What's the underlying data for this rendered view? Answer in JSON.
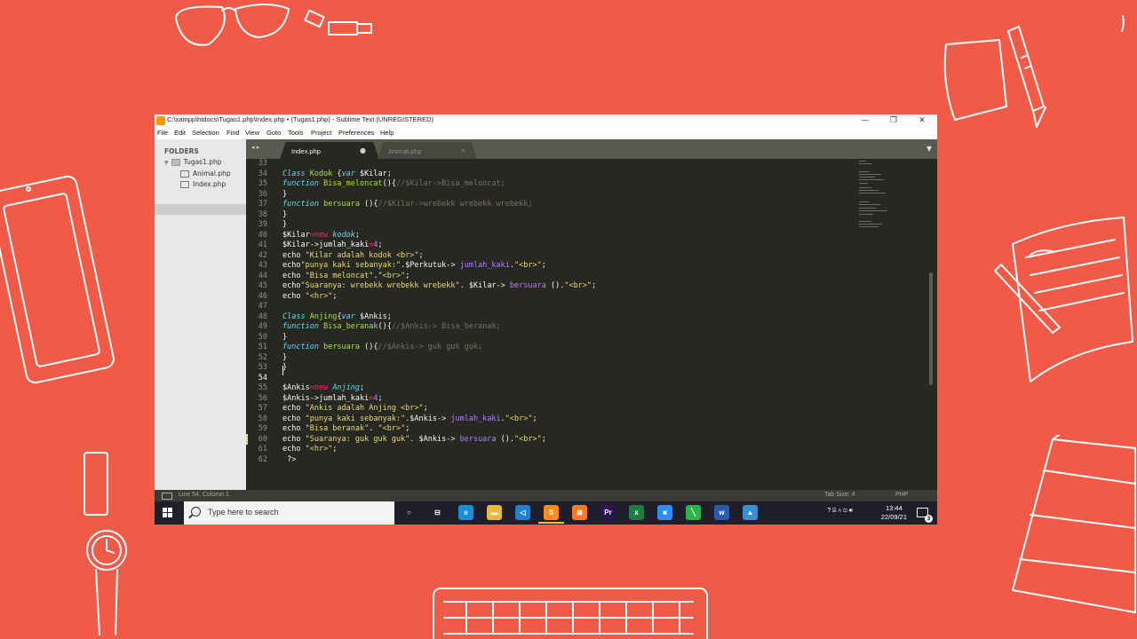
{
  "window": {
    "title": "C:\\xampp\\htdocs\\Tugas1.php\\Index.php • (Tugas1.php) - Sublime Text (UNREGISTERED)",
    "controls": {
      "minimize": "—",
      "maximize": "❐",
      "close": "✕"
    }
  },
  "menu": [
    "File",
    "Edit",
    "Selection",
    "Find",
    "View",
    "Goto",
    "Tools",
    "Project",
    "Preferences",
    "Help"
  ],
  "sidebar": {
    "heading": "FOLDERS",
    "folder": "Tugas1.php",
    "files": [
      "Animal.php",
      "Index.php"
    ],
    "selected": "Index.php"
  },
  "tabs": [
    {
      "label": "Index.php",
      "mark": "●",
      "active": true
    },
    {
      "label": "Animal.php",
      "mark": "×",
      "active": false
    }
  ],
  "tabbar": {
    "nav": "◂ ▸",
    "dropdown": "▼"
  },
  "editor": {
    "line_numbers": [
      "33",
      "34",
      "35",
      "36",
      "37",
      "38",
      "39",
      "40",
      "41",
      "42",
      "43",
      "44",
      "45",
      "46",
      "47",
      "48",
      "49",
      "50",
      "51",
      "52",
      "53",
      "54",
      "55",
      "56",
      "57",
      "58",
      "59",
      "60",
      "61",
      "62"
    ],
    "cursor_line": 54
  },
  "status": {
    "position": "Line 54, Column 1",
    "tab_size": "Tab Size: 4",
    "syntax": "PHP"
  },
  "taskbar": {
    "search_placeholder": "Type here to search",
    "apps": [
      {
        "name": "task-view",
        "glyph": "○",
        "color": "#1f1f2b"
      },
      {
        "name": "widgets",
        "glyph": "⊟",
        "color": "#1f1f2b"
      },
      {
        "name": "edge",
        "glyph": "e",
        "color": "#1b8fd6"
      },
      {
        "name": "file-explorer",
        "glyph": "▬",
        "color": "#e8b93a"
      },
      {
        "name": "vscode",
        "glyph": "◁",
        "color": "#2480c8"
      },
      {
        "name": "sublime-text",
        "glyph": "S",
        "color": "#ff8c1a"
      },
      {
        "name": "xampp",
        "glyph": "⊠",
        "color": "#fb7a24"
      },
      {
        "name": "premiere",
        "glyph": "Pr",
        "color": "#2a1554"
      },
      {
        "name": "excel",
        "glyph": "x",
        "color": "#1f7a44"
      },
      {
        "name": "zoom",
        "glyph": "■",
        "color": "#2d8cff"
      },
      {
        "name": "green-app",
        "glyph": "╲",
        "color": "#29b34a"
      },
      {
        "name": "word",
        "glyph": "w",
        "color": "#2a5aab"
      },
      {
        "name": "photos",
        "glyph": "▲",
        "color": "#3a8fd0"
      }
    ],
    "tray": "? ⌸ ∧ ⊡ 🔊︎",
    "time": "13:44",
    "date": "22/09/21",
    "notification_count": "3"
  }
}
